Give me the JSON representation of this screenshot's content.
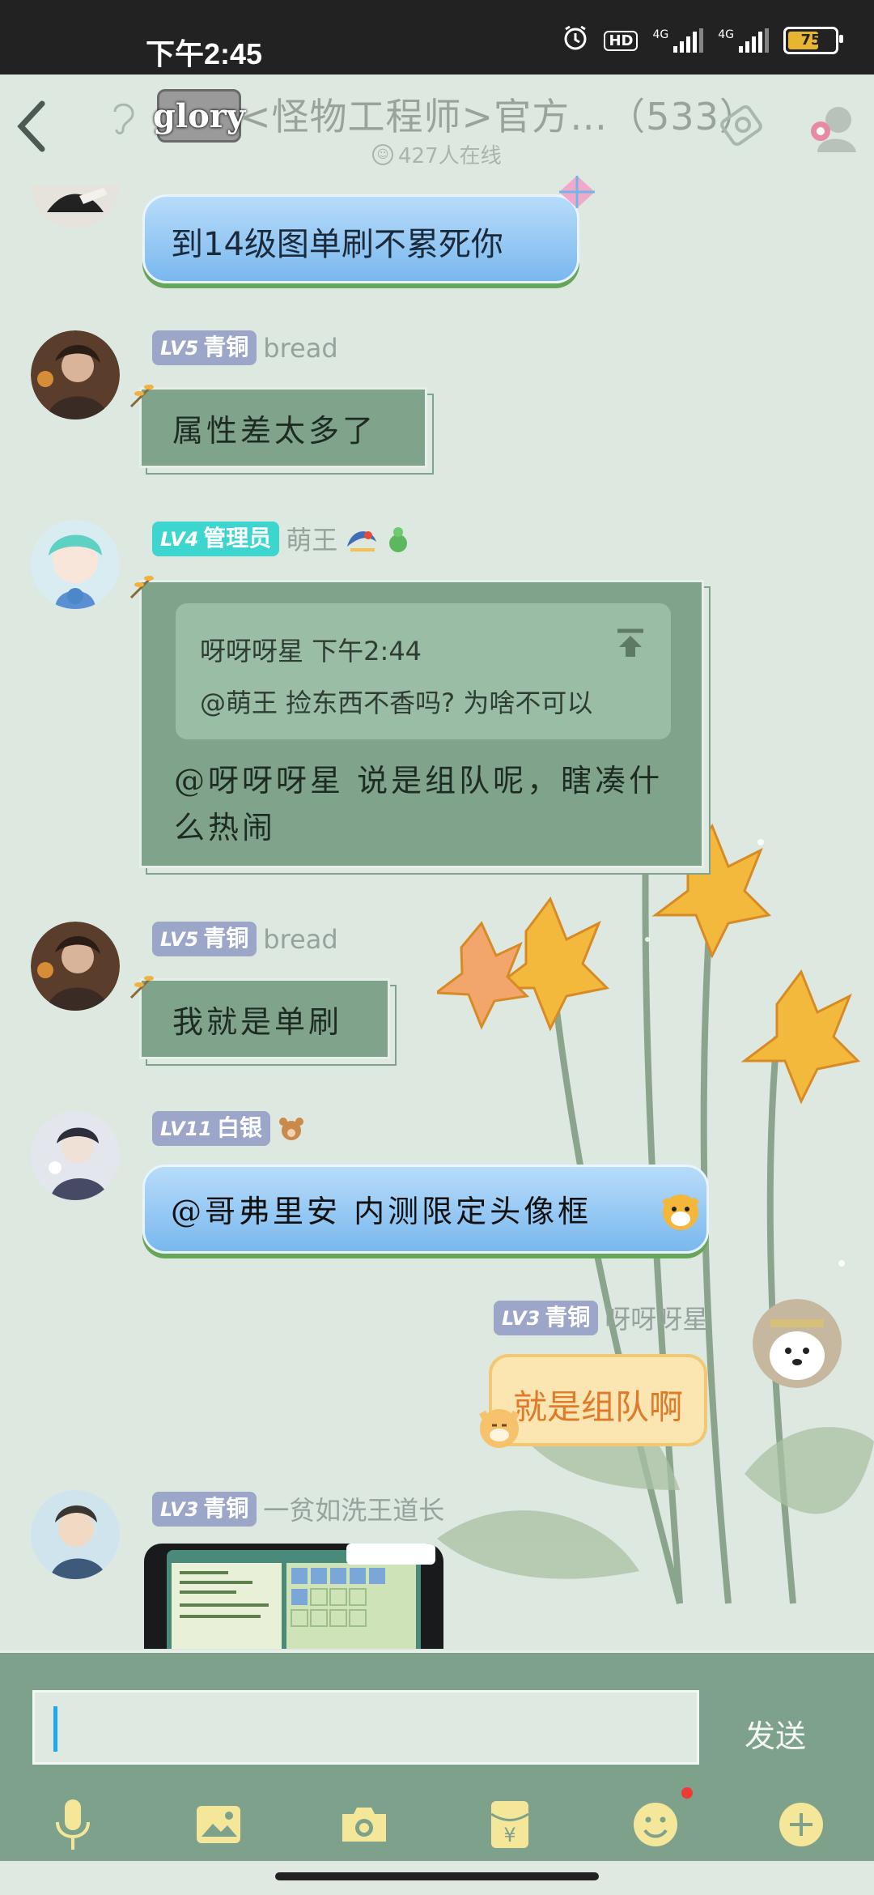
{
  "status_bar": {
    "time": "下午2:45",
    "hd": "HD",
    "net1": "4G",
    "net2": "4G",
    "battery": "75"
  },
  "header": {
    "group_logo_text": "glory",
    "group_title": "<怪物工程师>官方…（533）",
    "online": "427人在线"
  },
  "messages": [
    {
      "text": "到14级图单刷不累死你"
    },
    {
      "level": "LV5",
      "rank": "青铜",
      "name": "bread",
      "text": "属性差太多了"
    },
    {
      "level": "LV4",
      "rank": "管理员",
      "name": "萌王",
      "quote_author": "呀呀呀星 下午2:44",
      "quote_text": "@萌王 捡东西不香吗? 为啥不可以",
      "text": "@呀呀呀星 说是组队呢，瞎凑什么热闹"
    },
    {
      "level": "LV5",
      "rank": "青铜",
      "name": "bread",
      "text": "我就是单刷"
    },
    {
      "level": "LV11",
      "rank": "白银",
      "name": "",
      "text": "@哥弗里安 内测限定头像框"
    },
    {
      "level": "LV3",
      "rank": "青铜",
      "name": "呀呀呀星",
      "text": "就是组队啊"
    },
    {
      "level": "LV3",
      "rank": "青铜",
      "name": "一贫如洗王道长"
    }
  ],
  "composer": {
    "input_value": "",
    "send_label": "发送",
    "tools": [
      "microphone-icon",
      "image-icon",
      "camera-icon",
      "red-packet-icon",
      "emoji-icon",
      "plus-icon"
    ]
  },
  "colors": {
    "accent_green": "#7ea18b",
    "background": "#dde8e0",
    "badge_bronze": "#9ba6c9",
    "badge_admin": "#3cd6cf"
  }
}
